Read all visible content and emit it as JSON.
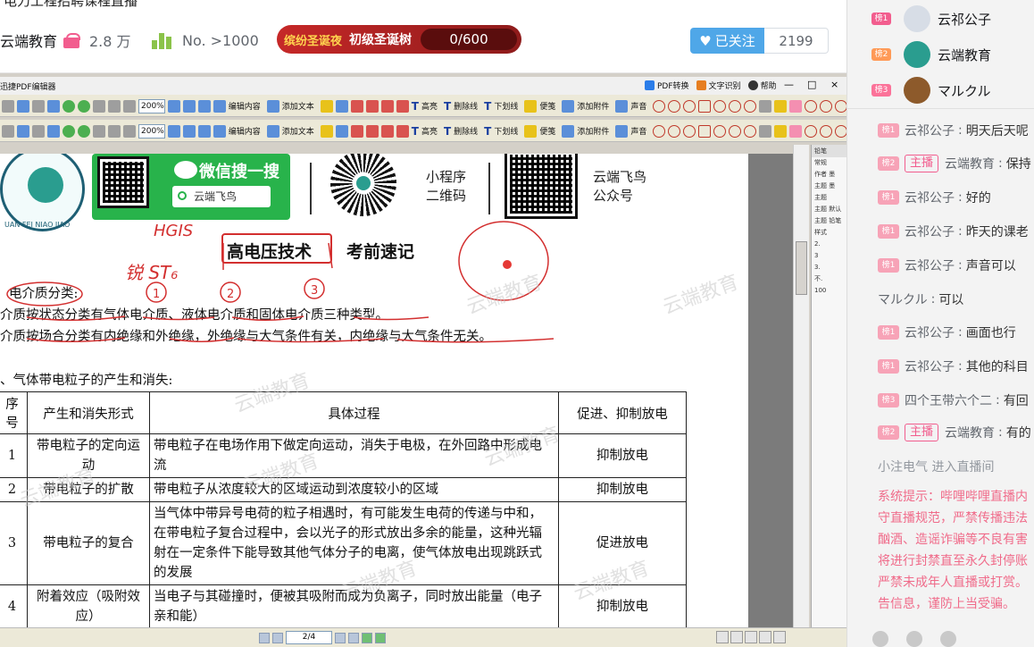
{
  "header": {
    "title_fragment": "电力工程招聘课程直播",
    "owner": "云端教育",
    "gift_count": "2.8 万",
    "rank": "No. >1000",
    "banner": {
      "tag": "缤纷圣诞夜",
      "name": "初级圣诞树",
      "progress": "0/600"
    },
    "follow_label": "已关注",
    "follower_count": "2199"
  },
  "pdf": {
    "window_title": "迅捷PDF编辑器",
    "menu": [
      "PDF转换",
      "文字识别",
      "帮助"
    ],
    "window_buttons": [
      "—",
      "□",
      "×"
    ],
    "zoom": "200%",
    "tools": [
      "编辑内容",
      "添加文本",
      "高亮",
      "删除线",
      "下划线",
      "便笺",
      "添加附件",
      "声音"
    ],
    "page_indicator": "2/4",
    "side_panel": {
      "title": "铅笔",
      "rows": [
        "常规",
        "作者 墨",
        "主题 墨",
        "主题",
        "主题 默认",
        "主题 铅笔",
        "样式",
        "2.",
        "3",
        "3.",
        "不.",
        "100"
      ]
    },
    "doc": {
      "wechat_search_title": "微信搜一搜",
      "wechat_search_value": "云端飞鸟",
      "logo_text": "UAN FEI NIAO JIAO",
      "miniprogram_label": [
        "小程序",
        "二维码"
      ],
      "official_label": [
        "云端飞鸟",
        "公众号"
      ],
      "title": "高电压技术",
      "subtitle": "考前速记",
      "lines": [
        "电介质分类:",
        "介质按状态分类有气体电介质、液体电介质和固体电介质三种类型。",
        "介质按场合分类有内绝缘和外绝缘，外绝缘与大气条件有关，内绝缘与大气条件无关。",
        "、气体带电粒子的产生和消失:"
      ],
      "table_headers": [
        "序号",
        "产生和消失形式",
        "具体过程",
        "促进、抑制放电"
      ],
      "table_rows": [
        {
          "no": "1",
          "form": "带电粒子的定向运动",
          "process": "带电粒子在电场作用下做定向运动，消失于电极，在外回路中形成电流",
          "effect": "抑制放电"
        },
        {
          "no": "2",
          "form": "带电粒子的扩散",
          "process": "带电粒子从浓度较大的区域运动到浓度较小的区域",
          "effect": "抑制放电"
        },
        {
          "no": "3",
          "form": "带电粒子的复合",
          "process": "当气体中带异号电荷的粒子相遇时，有可能发生电荷的传递与中和，在带电粒子复合过程中，会以光子的形式放出多余的能量，这种光辐射在一定条件下能导致其他气体分子的电离，使气体放电出现跳跃式的发展",
          "effect": "促进放电"
        },
        {
          "no": "4",
          "form": "附着效应（吸附效应）",
          "process": "当电子与其碰撞时，便被其吸附而成为负离子，同时放出能量（电子亲和能）",
          "effect": "抑制放电"
        }
      ],
      "watermark": "云端教育"
    },
    "handwriting": [
      "HGIS",
      "锐 ST₆",
      "1",
      "2",
      "3"
    ]
  },
  "chat": {
    "top_ranks": [
      {
        "badge": "榜1",
        "name": "云祁公子",
        "color": "#f25d8e"
      },
      {
        "badge": "榜2",
        "name": "云端教育",
        "color": "#ff9a57"
      },
      {
        "badge": "榜3",
        "name": "マルクル",
        "color": "#fb7299"
      }
    ],
    "messages": [
      {
        "badge": "榜1",
        "host": "",
        "name": "云祁公子",
        "text": "明天后天呢"
      },
      {
        "badge": "榜2",
        "host": "主播",
        "name": "云端教育",
        "text": "保持"
      },
      {
        "badge": "榜1",
        "host": "",
        "name": "云祁公子",
        "text": "好的"
      },
      {
        "badge": "榜1",
        "host": "",
        "name": "云祁公子",
        "text": "昨天的课老"
      },
      {
        "badge": "榜1",
        "host": "",
        "name": "云祁公子",
        "text": "声音可以"
      },
      {
        "badge": "",
        "host": "",
        "name": "マルクル",
        "text": "可以"
      },
      {
        "badge": "榜1",
        "host": "",
        "name": "云祁公子",
        "text": "画面也行"
      },
      {
        "badge": "榜1",
        "host": "",
        "name": "云祁公子",
        "text": "其他的科目"
      },
      {
        "badge": "榜3",
        "host": "",
        "name": "四个王带六个二",
        "text": "有回"
      },
      {
        "badge": "榜2",
        "host": "主播",
        "name": "云端教育",
        "text": "有的"
      }
    ],
    "enter_notice": "小注电气 进入直播间",
    "system_notice": "系统提示：哔哩哔哩直播内\n守直播规范，严禁传播违法\n酗酒、造谣诈骗等不良有害\n将进行封禁直至永久封停账\n严禁未成年人直播或打赏。\n告信息，谨防上当受骗。"
  },
  "colors": {
    "accent": "#f25d8e",
    "follow": "#4fa7e8",
    "wechat": "#28b34b",
    "system": "#f06b8a"
  }
}
